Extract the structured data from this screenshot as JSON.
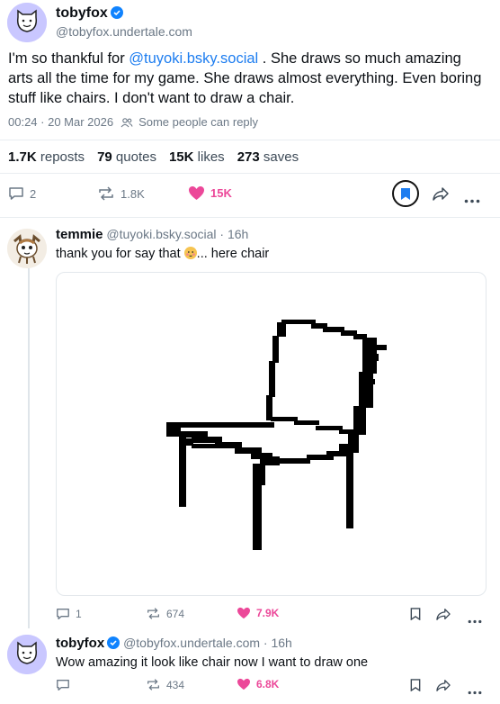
{
  "main_post": {
    "author_name": "tobyfox",
    "author_handle": "@tobyfox.undertale.com",
    "text_prefix": "I'm so thankful for ",
    "mention": "@tuyoki.bsky.social",
    "text_suffix": " . She draws so much amazing arts all the time for my game. She draws almost everything. Even boring stuff like chairs. I don't want to draw a chair.",
    "timestamp": "00:24 · 20 Mar 2026",
    "reply_setting": "Some people can reply",
    "stats": {
      "reposts_count": "1.7K",
      "reposts_label": "reposts",
      "quotes_count": "79",
      "quotes_label": "quotes",
      "likes_count": "15K",
      "likes_label": "likes",
      "saves_count": "273",
      "saves_label": "saves"
    },
    "actions": {
      "replies": "2",
      "reposts": "1.8K",
      "likes": "15K"
    }
  },
  "reply1": {
    "author_name": "temmie",
    "author_handle": "@tuyoki.bsky.social",
    "time": "· 16h",
    "text_before": "thank you for say that ",
    "text_after": "... here chair",
    "image_icon": "chair-drawing",
    "actions": {
      "replies": "1",
      "reposts": "674",
      "likes": "7.9K"
    }
  },
  "reply2": {
    "author_name": "tobyfox",
    "author_handle": "@tobyfox.undertale.com",
    "time": "· 16h",
    "text": "Wow amazing it look like chair now I want to draw one",
    "actions": {
      "replies": "",
      "reposts": "434",
      "likes": "6.8K"
    }
  },
  "colors": {
    "accent": "#1d7df0",
    "like": "#ec4899",
    "muted": "#6b7886"
  }
}
